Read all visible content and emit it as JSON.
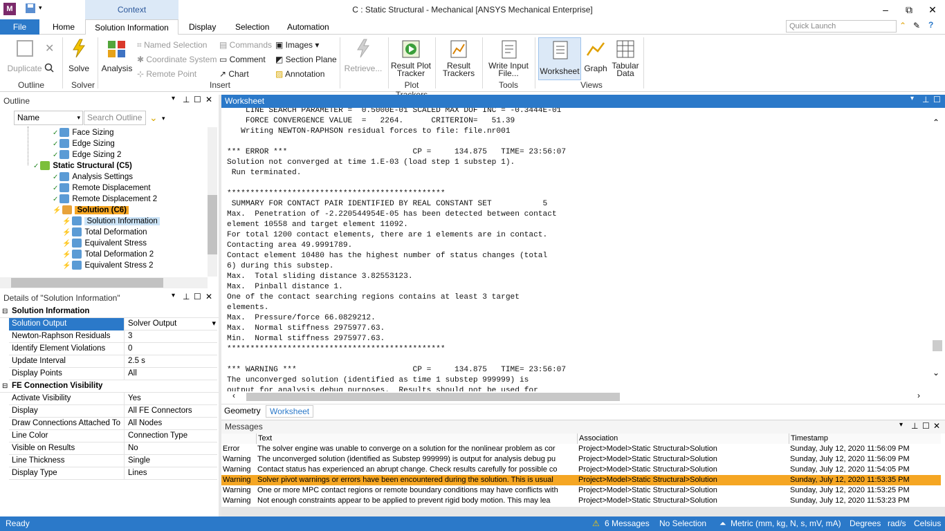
{
  "window": {
    "title": "C : Static Structural - Mechanical [ANSYS Mechanical Enterprise]",
    "context_label": "Context",
    "app_icon_letter": "M",
    "controls": [
      "–",
      "⧉",
      "✕"
    ]
  },
  "tabs": {
    "file": "File",
    "items": [
      "Home",
      "Solution Information",
      "Display",
      "Selection",
      "Automation"
    ],
    "active": "Solution Information"
  },
  "quick_launch": {
    "placeholder": "Quick Launch"
  },
  "ribbon": {
    "outline": {
      "duplicate": "Duplicate",
      "group": "Outline"
    },
    "solver": {
      "solve": "Solve",
      "group": "Solver"
    },
    "insert": {
      "analysis": "Analysis",
      "named_selection": "Named Selection",
      "coordinate_system": "Coordinate System",
      "remote_point": "Remote Point",
      "commands": "Commands",
      "comment": "Comment",
      "chart": "Chart",
      "images": "Images",
      "section_plane": "Section Plane",
      "annotation": "Annotation",
      "group": "Insert"
    },
    "retrieve": "Retrieve...",
    "plot_trackers": {
      "result_plot_tracker_1": "Result Plot",
      "result_plot_tracker_2": "Tracker",
      "group": "Plot Trackers"
    },
    "result_trackers": {
      "line1": "Result",
      "line2": "Trackers"
    },
    "tools": {
      "write_input_1": "Write Input",
      "write_input_2": "File...",
      "group": "Tools"
    },
    "views": {
      "worksheet": "Worksheet",
      "graph": "Graph",
      "tabular_1": "Tabular",
      "tabular_2": "Data",
      "group": "Views"
    }
  },
  "outline": {
    "title": "Outline",
    "name_filter": "Name",
    "search_placeholder": "Search Outline",
    "tree": [
      {
        "label": "Face Sizing",
        "indent": 4
      },
      {
        "label": "Edge Sizing",
        "indent": 4
      },
      {
        "label": "Edge Sizing 2",
        "indent": 4
      },
      {
        "label": "Static Structural (C5)",
        "indent": 2,
        "bold": true
      },
      {
        "label": "Analysis Settings",
        "indent": 4
      },
      {
        "label": "Remote Displacement",
        "indent": 4
      },
      {
        "label": "Remote Displacement 2",
        "indent": 4
      },
      {
        "label": "Solution (C6)",
        "indent": 4,
        "bold": true,
        "highlight": true
      },
      {
        "label": "Solution Information",
        "indent": 5,
        "selected": true
      },
      {
        "label": "Total Deformation",
        "indent": 5
      },
      {
        "label": "Equivalent Stress",
        "indent": 5
      },
      {
        "label": "Total Deformation 2",
        "indent": 5
      },
      {
        "label": "Equivalent Stress 2",
        "indent": 5
      }
    ]
  },
  "details": {
    "title": "Details of \"Solution Information\"",
    "section1": "Solution Information",
    "rows1": [
      {
        "k": "Solution Output",
        "v": "Solver Output",
        "selected": true
      },
      {
        "k": "Newton-Raphson Residuals",
        "v": "3"
      },
      {
        "k": "Identify Element Violations",
        "v": "0"
      },
      {
        "k": "Update Interval",
        "v": "2.5 s"
      },
      {
        "k": "Display Points",
        "v": "All"
      }
    ],
    "section2": "FE Connection Visibility",
    "rows2": [
      {
        "k": "Activate Visibility",
        "v": "Yes"
      },
      {
        "k": "Display",
        "v": "All FE Connectors"
      },
      {
        "k": "Draw Connections Attached To",
        "v": "All Nodes"
      },
      {
        "k": "Line Color",
        "v": "Connection Type"
      },
      {
        "k": "Visible on Results",
        "v": "No"
      },
      {
        "k": "Line Thickness",
        "v": "Single"
      },
      {
        "k": "Display Type",
        "v": "Lines"
      }
    ]
  },
  "worksheet": {
    "title": "Worksheet",
    "lines": [
      "    LINE SEARCH PARAMETER =  0.5000E-01 SCALED MAX DOF INC = -0.3444E-01",
      "    FORCE CONVERGENCE VALUE  =   2264.      CRITERION=   51.39",
      "   Writing NEWTON-RAPHSON residual forces to file: file.nr001",
      "",
      "*** ERROR ***                           CP =     134.875   TIME= 23:56:07",
      "Solution not converged at time 1.E-03 (load step 1 substep 1).",
      " Run terminated.",
      "",
      "***********************************************",
      " SUMMARY FOR CONTACT PAIR IDENTIFIED BY REAL CONSTANT SET           5",
      "Max.  Penetration of -2.220544954E-05 has been detected between contact",
      "element 10558 and target element 11092.",
      "For total 1200 contact elements, there are 1 elements are in contact.",
      "Contacting area 49.9991789.",
      "Contact element 10480 has the highest number of status changes (total",
      "6) during this substep.",
      "Max.  Total sliding distance 3.82553123.",
      "Max.  Pinball distance 1.",
      "One of the contact searching regions contains at least 3 target",
      "elements.",
      "Max.  Pressure/force 66.0829212.",
      "Max.  Normal stiffness 2975977.63.",
      "Min.  Normal stiffness 2975977.63.",
      "***********************************************",
      "",
      "*** WARNING ***                         CP =     134.875   TIME= 23:56:07",
      "The unconverged solution (identified as time 1 substep 999999) is",
      "output for analysis debug purposes.  Results should not be used for"
    ],
    "bottom_tabs": [
      "Geometry",
      "Worksheet"
    ]
  },
  "messages": {
    "title": "Messages",
    "columns": [
      "Text",
      "Association",
      "Timestamp"
    ],
    "rows": [
      {
        "type": "Error",
        "text": "The solver engine was unable to converge on a solution for the nonlinear problem as cor",
        "assoc": "Project>Model>Static Structural>Solution",
        "time": "Sunday, July 12, 2020 11:56:09 PM"
      },
      {
        "type": "Warning",
        "text": "The unconverged solution (identified as Substep 999999) is output for analysis debug pu",
        "assoc": "Project>Model>Static Structural>Solution",
        "time": "Sunday, July 12, 2020 11:56:09 PM"
      },
      {
        "type": "Warning",
        "text": "Contact status has experienced an abrupt change.  Check results carefully for possible co",
        "assoc": "Project>Model>Static Structural>Solution",
        "time": "Sunday, July 12, 2020 11:54:05 PM"
      },
      {
        "type": "Warning",
        "text": "Solver pivot warnings or errors have been encountered during the solution.  This is usual",
        "assoc": "Project>Model>Static Structural>Solution",
        "time": "Sunday, July 12, 2020 11:53:35 PM",
        "highlight": true
      },
      {
        "type": "Warning",
        "text": "One or more MPC contact regions or remote boundary conditions may have conflicts with",
        "assoc": "Project>Model>Static Structural>Solution",
        "time": "Sunday, July 12, 2020 11:53:25 PM"
      },
      {
        "type": "Warning",
        "text": "Not enough constraints appear to be applied to prevent rigid body motion.  This may lea",
        "assoc": "Project>Model>Static Structural>Solution",
        "time": "Sunday, July 12, 2020 11:53:23 PM"
      }
    ]
  },
  "status": {
    "ready": "Ready",
    "messages": "6 Messages",
    "selection": "No Selection",
    "units": "Metric (mm, kg, N, s, mV, mA)",
    "angle": "Degrees",
    "rot": "rad/s",
    "temp": "Celsius"
  },
  "colors": {
    "accent": "#2b79c9",
    "highlight": "#f5a623",
    "selected": "#cce4f7"
  }
}
